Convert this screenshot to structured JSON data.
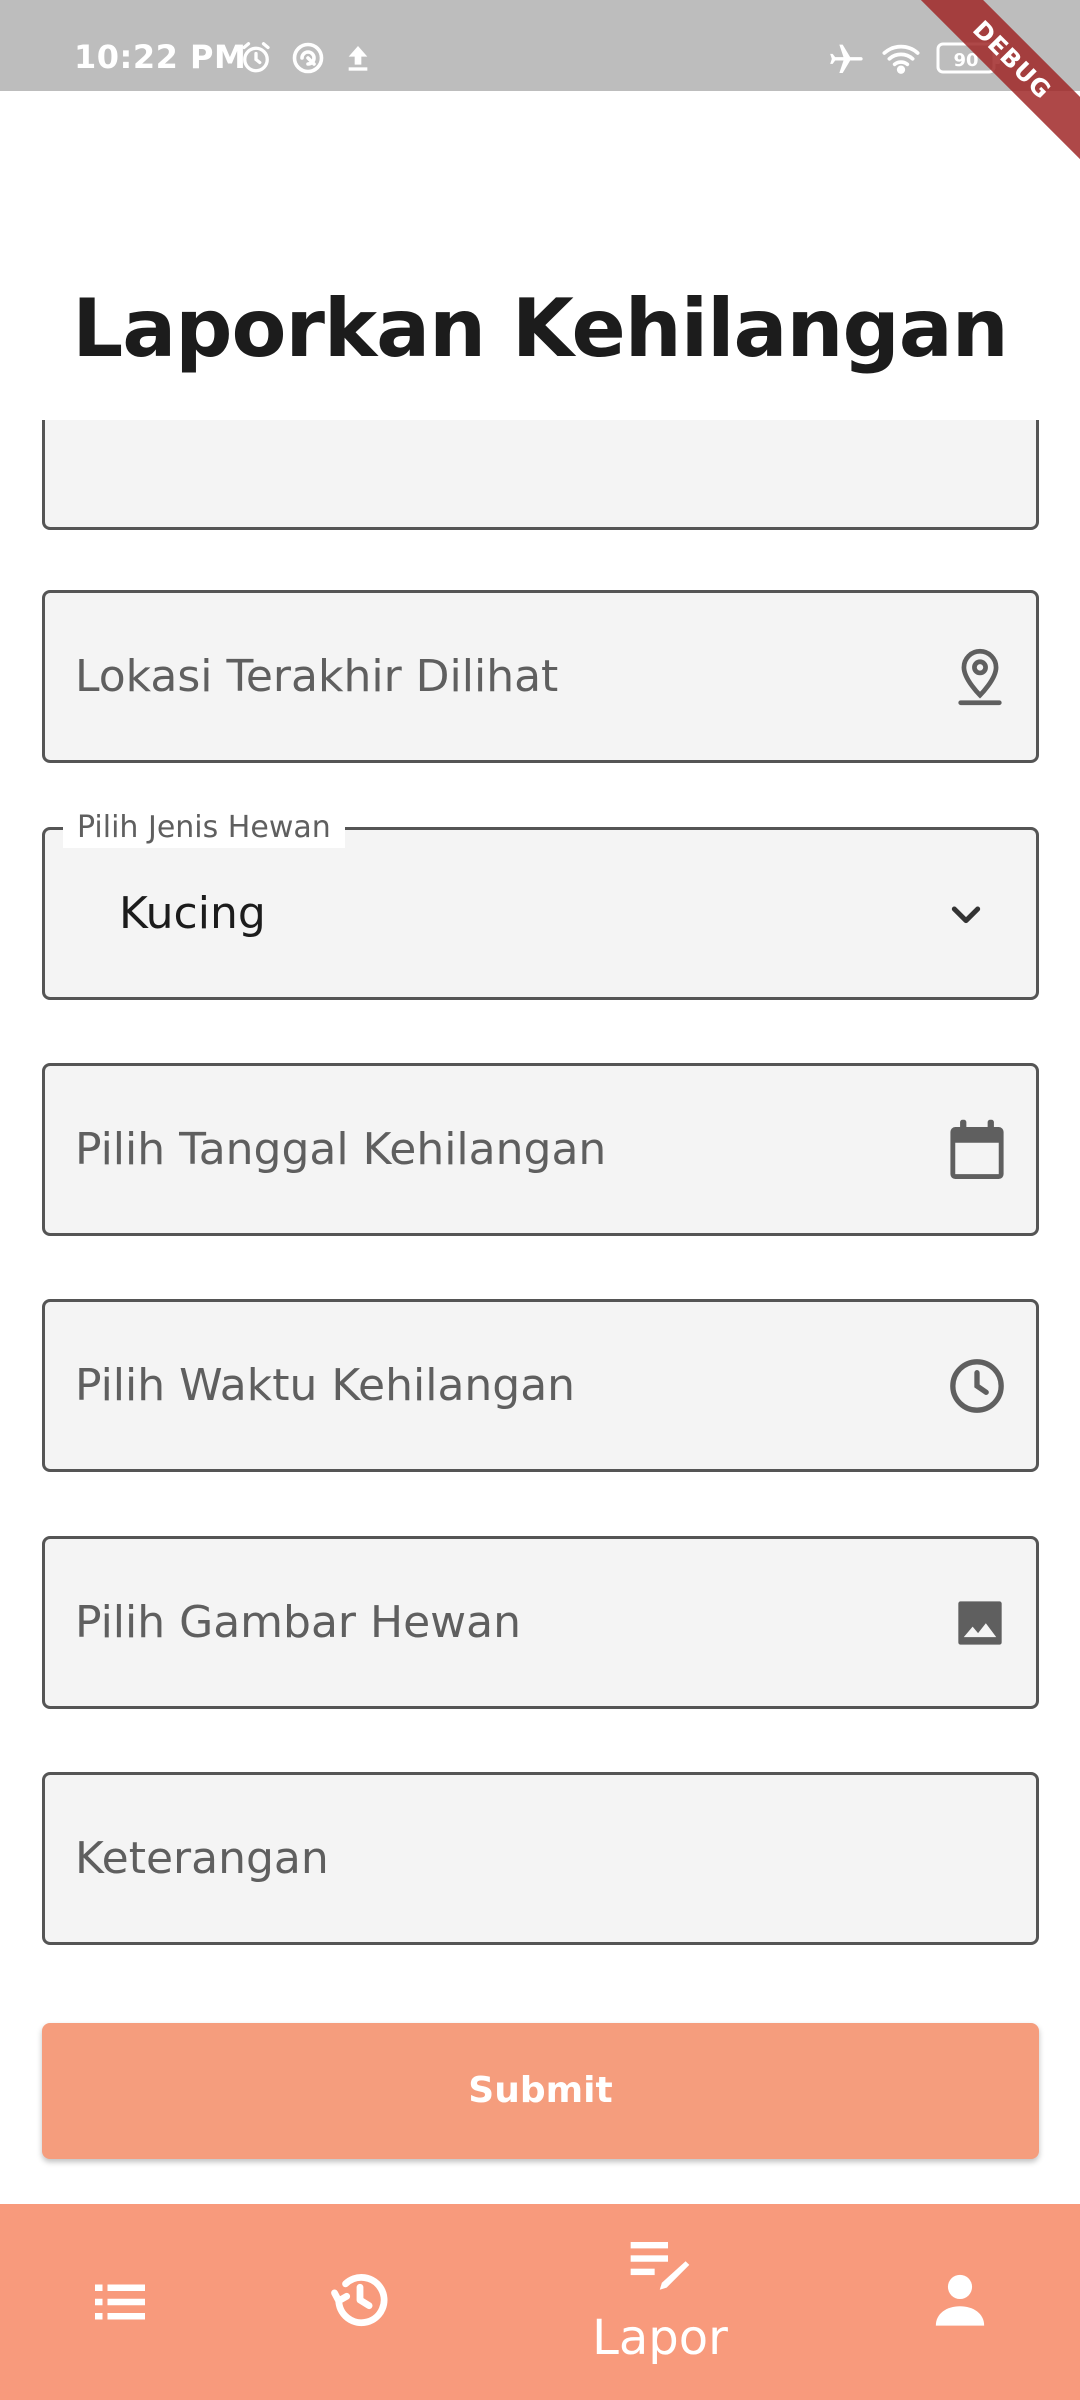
{
  "status_bar": {
    "time": "10:22 PM",
    "battery_level": "90",
    "icons": [
      "alarm-icon",
      "vpn-icon",
      "upload-icon",
      "airplane-mode-icon",
      "wifi-icon",
      "battery-icon"
    ]
  },
  "debug_banner": "DEBUG",
  "page": {
    "title": "Laporkan Kehilangan"
  },
  "form": {
    "location_placeholder": "Lokasi Terakhir Dilihat",
    "animal_type_label": "Pilih Jenis Hewan",
    "animal_type_value": "Kucing",
    "date_placeholder": "Pilih Tanggal Kehilangan",
    "time_placeholder": "Pilih Waktu Kehilangan",
    "image_placeholder": "Pilih Gambar Hewan",
    "notes_placeholder": "Keterangan",
    "submit_label": "Submit"
  },
  "bottom_nav": {
    "items": [
      {
        "icon": "list-icon",
        "label": ""
      },
      {
        "icon": "history-icon",
        "label": ""
      },
      {
        "icon": "edit-note-icon",
        "label": "Lapor",
        "active": true
      },
      {
        "icon": "person-icon",
        "label": ""
      }
    ]
  },
  "colors": {
    "status_bar_bg": "#bdbdbd",
    "accent": "#f89a7c",
    "submit_bg": "#f59d7d",
    "field_bg": "#f4f4f4",
    "field_border": "#555555",
    "title_text": "#1c1c1c"
  }
}
